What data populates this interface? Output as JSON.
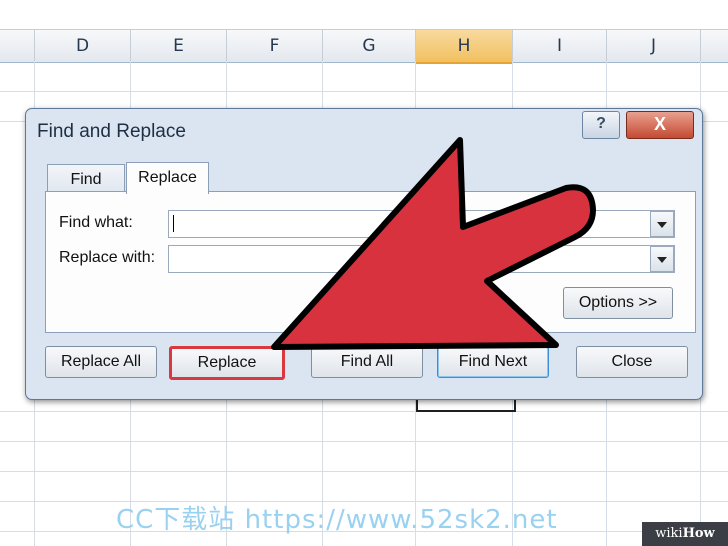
{
  "sheet": {
    "columns": [
      {
        "label": "D",
        "selected": false
      },
      {
        "label": "E",
        "selected": false
      },
      {
        "label": "F",
        "selected": false
      },
      {
        "label": "G",
        "selected": false
      },
      {
        "label": "H",
        "selected": true
      },
      {
        "label": "I",
        "selected": false
      },
      {
        "label": "J",
        "selected": false
      }
    ]
  },
  "dialog": {
    "title": "Find and Replace",
    "help_label": "?",
    "close_label": "X",
    "tabs": {
      "find": "Find",
      "replace": "Replace"
    },
    "find_what_label": "Find what:",
    "find_what_value": "",
    "replace_with_label": "Replace with:",
    "replace_with_value": "",
    "options_button": "Options >>",
    "buttons": {
      "replace_all": "Replace All",
      "replace": "Replace",
      "find_all": "Find All",
      "find_next": "Find Next",
      "close": "Close"
    }
  },
  "annotation": {
    "arrow_color": "#d9323f",
    "highlight_color": "#d8383e"
  },
  "watermark": "CC下载站 https://www.52sk2.net",
  "brand": {
    "prefix": "wiki",
    "suffix": "How"
  }
}
